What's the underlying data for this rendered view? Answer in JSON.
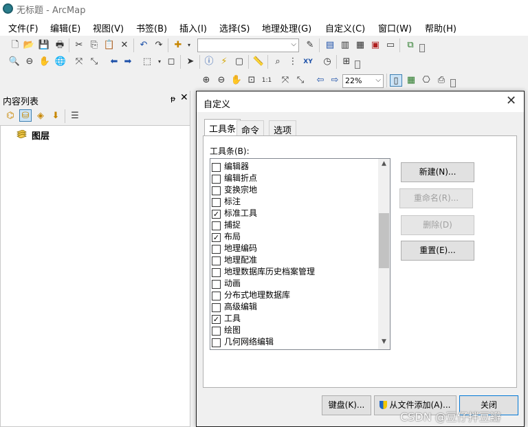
{
  "window": {
    "title": "无标题 - ArcMap"
  },
  "menu": [
    "文件(F)",
    "编辑(E)",
    "视图(V)",
    "书签(B)",
    "插入(I)",
    "选择(S)",
    "地理处理(G)",
    "自定义(C)",
    "窗口(W)",
    "帮助(H)"
  ],
  "toolbar": {
    "scale_value": "",
    "zoom_value": "22%"
  },
  "toc": {
    "title": "内容列表",
    "pin": "ᵽ",
    "close": "✕",
    "layers_label": "图层"
  },
  "dialog": {
    "title": "自定义",
    "close": "✕",
    "tabs": [
      "工具条",
      "命令",
      "选项"
    ],
    "list_label": "工具条(B):",
    "toolbars": [
      {
        "name": "编辑器",
        "checked": false
      },
      {
        "name": "编辑折点",
        "checked": false
      },
      {
        "name": "变换宗地",
        "checked": false
      },
      {
        "name": "标注",
        "checked": false
      },
      {
        "name": "标准工具",
        "checked": true
      },
      {
        "name": "捕捉",
        "checked": false
      },
      {
        "name": "布局",
        "checked": true
      },
      {
        "name": "地理编码",
        "checked": false
      },
      {
        "name": "地理配准",
        "checked": false
      },
      {
        "name": "地理数据库历史档案管理",
        "checked": false
      },
      {
        "name": "动画",
        "checked": false
      },
      {
        "name": "分布式地理数据库",
        "checked": false
      },
      {
        "name": "高级编辑",
        "checked": false
      },
      {
        "name": "工具",
        "checked": true
      },
      {
        "name": "绘图",
        "checked": false
      },
      {
        "name": "几何网络编辑",
        "checked": false
      }
    ],
    "side_buttons": {
      "new": "新建(N)...",
      "rename": "重命名(R)...",
      "delete": "删除(D)",
      "reset": "重置(E)..."
    },
    "bottom_buttons": {
      "keyboard": "键盘(K)...",
      "add_from_file": "从文件添加(A)...",
      "close": "关闭"
    }
  },
  "watermark": "CSDN @豆仔拌豆瓣",
  "colors": {
    "dialog_border": "#1a1a1a",
    "primary_focus": "#0078d7"
  }
}
